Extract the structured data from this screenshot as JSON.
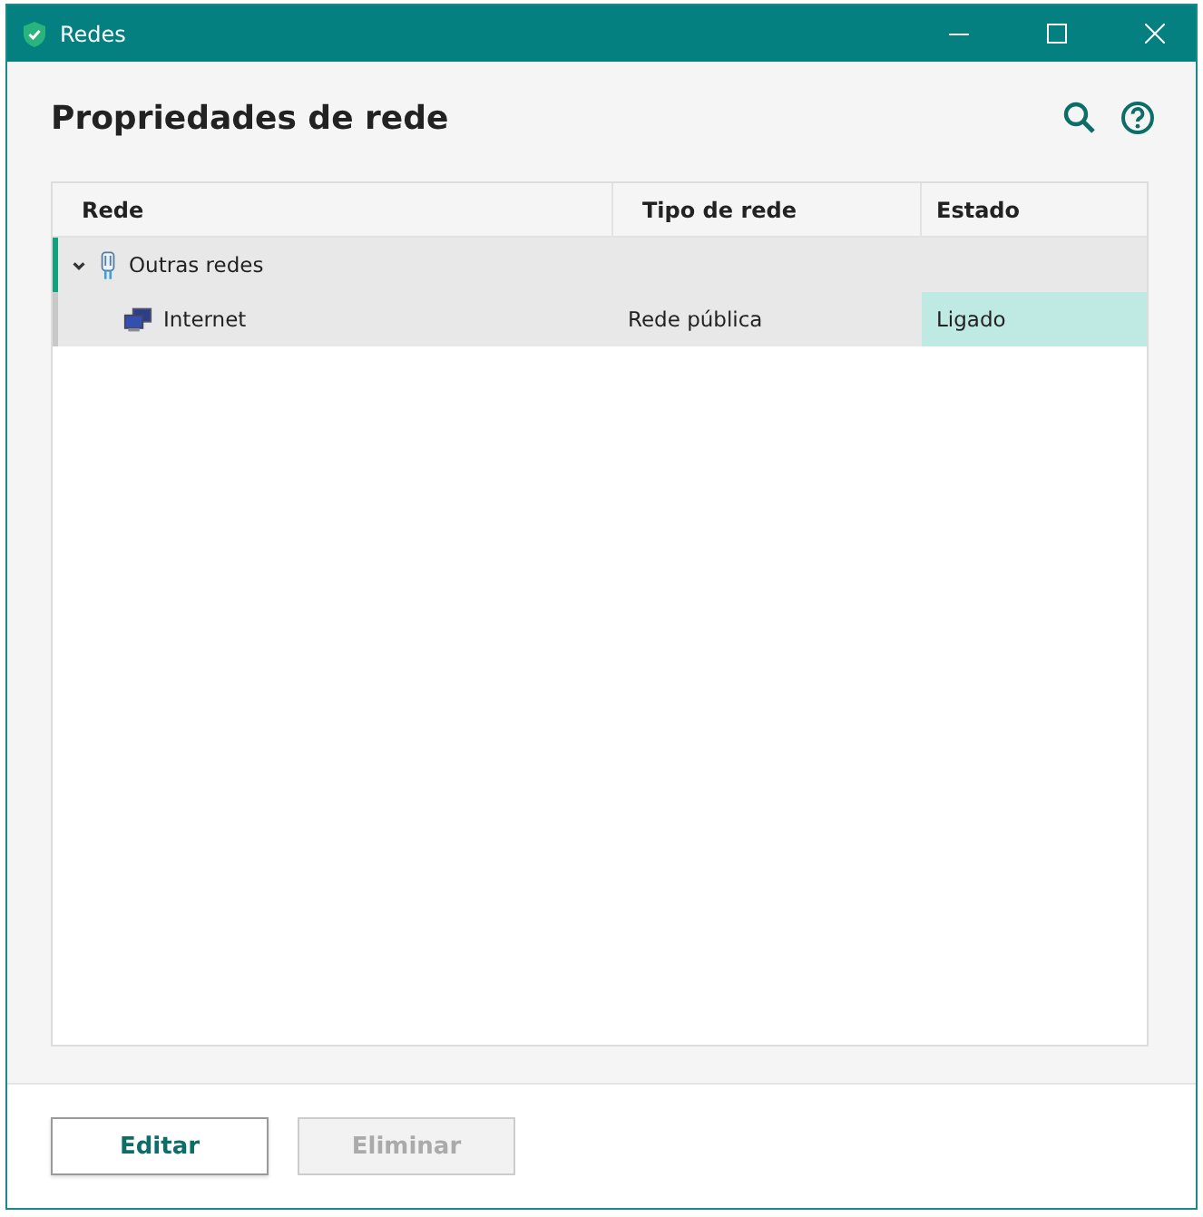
{
  "window": {
    "title": "Redes"
  },
  "header": {
    "title": "Propriedades de rede"
  },
  "table": {
    "columns": [
      "Rede",
      "Tipo de rede",
      "Estado"
    ],
    "rows": [
      {
        "name": "Outras redes",
        "kind": "group",
        "expanded": true,
        "selected": true,
        "children": [
          {
            "name": "Internet",
            "kind": "network",
            "type": "Rede pública",
            "status": "Ligado",
            "connected": true,
            "selected": false
          }
        ]
      }
    ]
  },
  "buttons": [
    {
      "label": "Editar",
      "disabled": false
    },
    {
      "label": "Eliminar",
      "disabled": true
    }
  ]
}
